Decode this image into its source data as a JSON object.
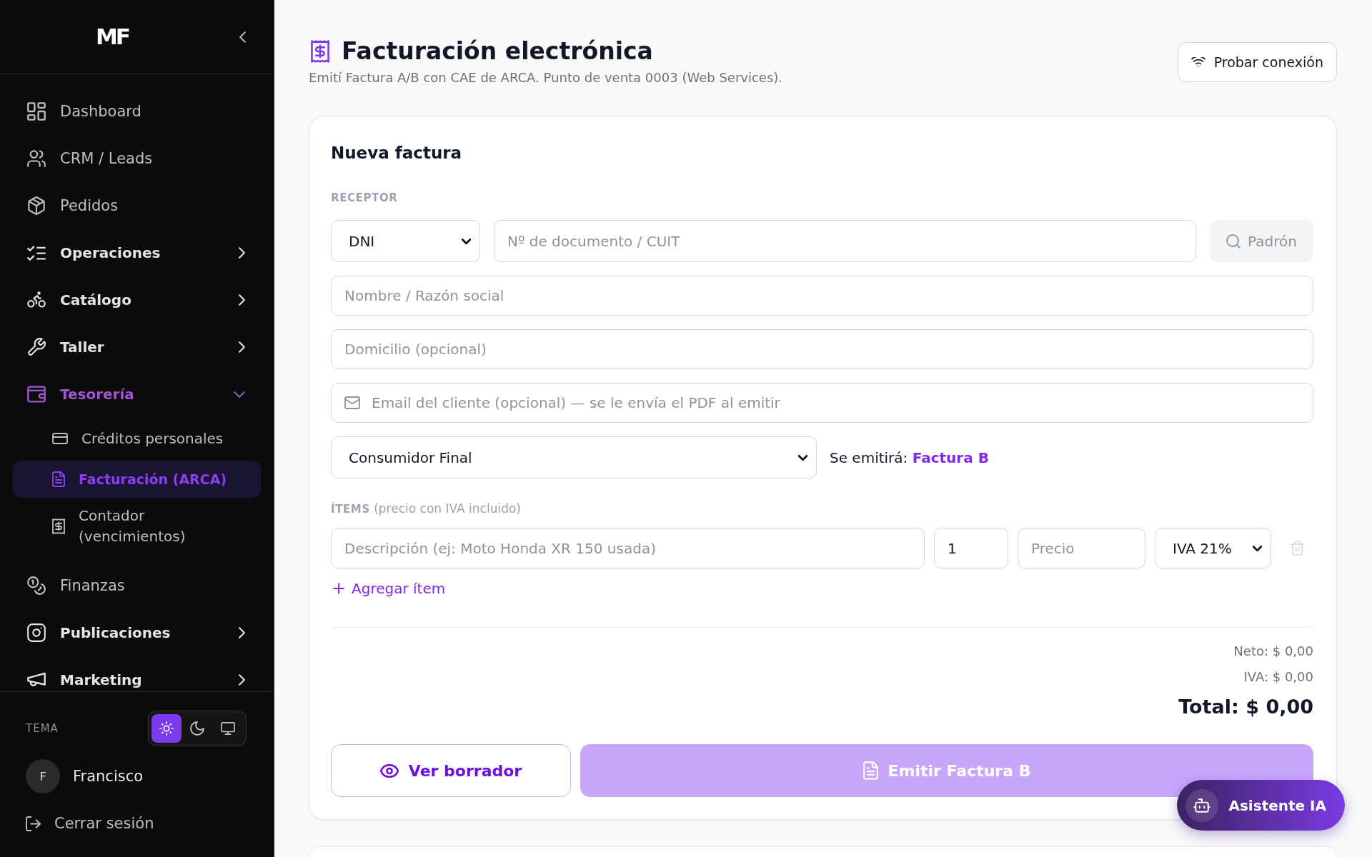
{
  "sidebar": {
    "logo": "MF",
    "nav": [
      {
        "label": "Dashboard",
        "selected": false
      },
      {
        "label": "CRM / Leads",
        "selected": false
      },
      {
        "label": "Pedidos",
        "selected": false
      },
      {
        "label": "Operaciones",
        "selected": false,
        "expanded": false
      },
      {
        "label": "Catálogo",
        "selected": false,
        "expanded": false
      },
      {
        "label": "Taller",
        "selected": false,
        "expanded": false
      },
      {
        "label": "Tesorería",
        "selected": false,
        "expanded": true,
        "children": [
          {
            "label": "Créditos personales",
            "selected": false
          },
          {
            "label": "Facturación (ARCA)",
            "selected": true
          },
          {
            "label": "Contador (vencimientos)",
            "selected": false
          }
        ]
      },
      {
        "label": "Finanzas",
        "selected": false
      },
      {
        "label": "Publicaciones",
        "selected": false,
        "expanded": false
      },
      {
        "label": "Marketing",
        "selected": false,
        "expanded": false
      }
    ],
    "theme": {
      "label": "TEMA",
      "options": [
        {
          "selected": true
        },
        {
          "selected": false
        },
        {
          "selected": false
        }
      ]
    },
    "user": {
      "initial": "F",
      "name": "Francisco"
    },
    "logout": "Cerrar sesión"
  },
  "header": {
    "title": "Facturación electrónica",
    "subtitle": "Emití Factura A/B con CAE de ARCA. Punto de venta 0003 (Web Services).",
    "test_button": "Probar conexión"
  },
  "invoice_form": {
    "title": "Nueva factura",
    "receiver_label": "RECEPTOR",
    "doc_type": "DNI",
    "doc_number": {
      "placeholder": "Nº de documento / CUIT"
    },
    "padron_button": {
      "label": "Padrón",
      "disabled": true
    },
    "name": {
      "placeholder": "Nombre / Razón social"
    },
    "address": {
      "placeholder": "Domicilio (opcional)"
    },
    "email": {
      "placeholder": "Email del cliente (opcional) — se le envía el PDF al emitir"
    },
    "tax_condition": "Consumidor Final",
    "invoice_note": "Se emitirá: **Factura B**",
    "items_label": "**ÍTEMS** (precio con IVA incluido)",
    "items": [
      {
        "description": {
          "placeholder": "Descripción (ej: Moto Honda XR 150 usada)"
        },
        "quantity": {
          "value": "1"
        },
        "price": {
          "placeholder": "Precio"
        },
        "vat": "IVA 21%",
        "removable": false
      }
    ],
    "add_item": "Agregar ítem",
    "totals": {
      "net": "Neto: $ 0,00",
      "vat": "IVA: $ 0,00",
      "total": "Total: $ 0,00"
    },
    "preview_button": "Ver borrador",
    "emit_button": {
      "label": "Emitir Factura B",
      "disabled": true
    }
  },
  "assistant_button": "Asistente IA"
}
